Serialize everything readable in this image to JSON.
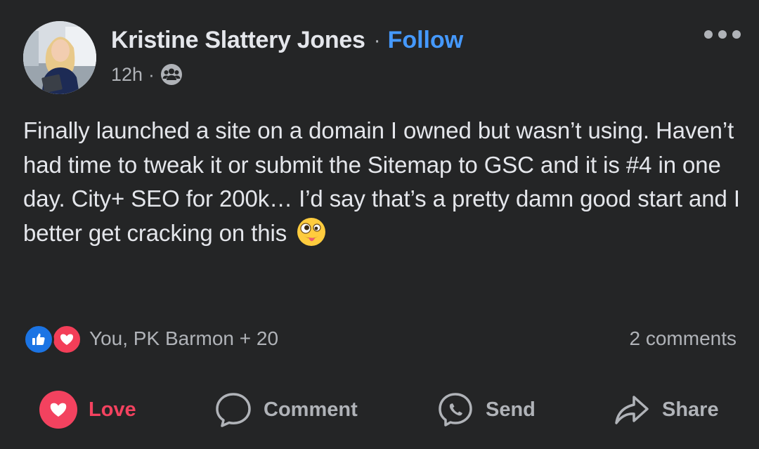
{
  "post": {
    "author": "Kristine Slattery Jones",
    "separator": "·",
    "follow_label": "Follow",
    "time": "12h",
    "meta_separator": "·",
    "audience_icon": "friends-group-icon",
    "body": "Finally launched a site on a domain I owned but wasn’t using. Haven’t had time to tweak it or submit the Sitemap to GSC and it is #4  in one day. City+ SEO for 200k… I’d say that’s a pretty damn good start and I better get cracking on this",
    "emoji": "zany-face-emoji"
  },
  "reactions": {
    "icons": [
      "like-reaction-icon",
      "love-reaction-icon"
    ],
    "summary": "You, PK Barmon + 20",
    "comments": "2 comments"
  },
  "actions": [
    {
      "label": "Love",
      "icon": "love-reaction-icon",
      "active": true
    },
    {
      "label": "Comment",
      "icon": "comment-bubble-icon"
    },
    {
      "label": "Send",
      "icon": "messenger-icon"
    },
    {
      "label": "Share",
      "icon": "share-arrow-icon"
    }
  ],
  "colors": {
    "background": "#242526",
    "primary_text": "#e4e6eb",
    "secondary_text": "#b0b3b8",
    "follow_blue": "#4599ff",
    "love_red": "#f3425f",
    "like_blue": "#1b74e4"
  }
}
